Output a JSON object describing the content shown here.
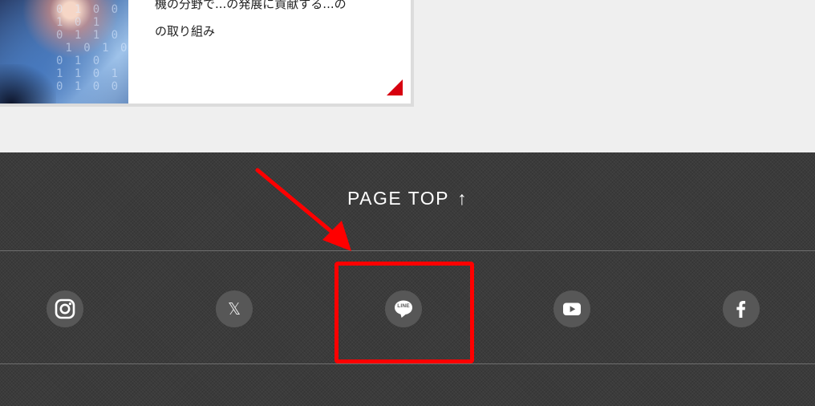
{
  "article_card": {
    "text_line1": "機の分野で...の発展に貢献する...の",
    "text_line2": "の取り組み",
    "thumb_digits": "0 1 0 0\n1 0 1\n0 1 1 0\n 1 0 1 0\n0 1 0\n1 1 0 1\n0 1 0 0",
    "accent_color": "#d7000f"
  },
  "footer": {
    "page_top_label": "PAGE TOP",
    "page_top_arrow": "↑",
    "social_links": [
      {
        "name": "Instagram",
        "icon": "instagram-icon"
      },
      {
        "name": "X",
        "icon": "x-icon",
        "glyph": "𝕏"
      },
      {
        "name": "LINE",
        "icon": "line-icon",
        "badge_text": "LINE"
      },
      {
        "name": "YouTube",
        "icon": "youtube-icon"
      },
      {
        "name": "Facebook",
        "icon": "facebook-icon"
      }
    ]
  },
  "annotation": {
    "color": "#ff0000",
    "target": "LINE"
  }
}
